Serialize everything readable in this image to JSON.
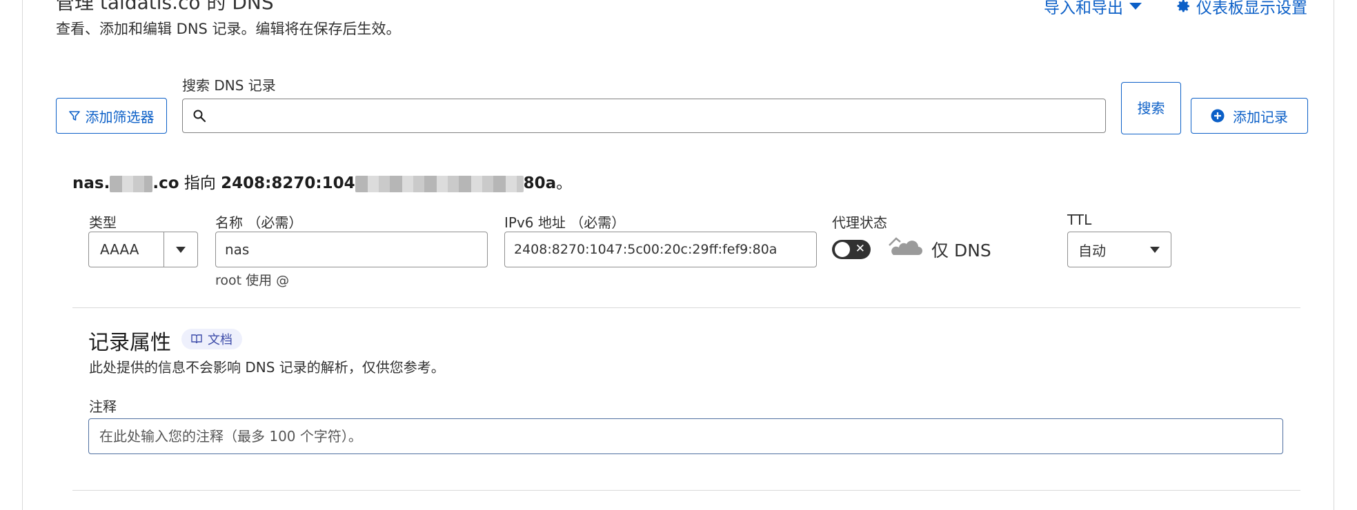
{
  "header": {
    "title": "管理 taidatis.co 的 DNS",
    "subtitle": "查看、添加和编辑 DNS 记录。编辑将在保存后生效。",
    "import_export_label": "导入和导出",
    "dashboard_settings_label": "仪表板显示设置"
  },
  "search": {
    "filter_button_label": "添加筛选器",
    "label": "搜索 DNS 记录",
    "value": "",
    "search_button_label": "搜索",
    "add_record_label": "添加记录"
  },
  "record": {
    "summary_name_start": "nas.",
    "summary_name_end": ".co",
    "summary_points_to": "指向",
    "summary_value_start": "2408:8270:104",
    "summary_value_end": "80a",
    "summary_end": "。",
    "type_label": "类型",
    "type_value": "AAAA",
    "name_label": "名称 （必需）",
    "name_value": "nas",
    "name_hint": "root 使用 @",
    "ipv6_label": "IPv6 地址 （必需）",
    "ipv6_value": "2408:8270:1047:5c00:20c:29ff:fef9:80a",
    "proxy_label": "代理状态",
    "proxy_enabled": false,
    "proxy_text": "仅 DNS",
    "ttl_label": "TTL",
    "ttl_value": "自动"
  },
  "attributes": {
    "title": "记录属性",
    "doc_badge": "文档",
    "description": "此处提供的信息不会影响 DNS 记录的解析，仅供您参考。",
    "note_label": "注释",
    "note_placeholder": "在此处输入您的注释（最多 100 个字符）。",
    "note_value": ""
  },
  "colors": {
    "accent": "#0b5fc7",
    "toggle_off": "#313131",
    "badge_bg": "#eef0fc"
  }
}
